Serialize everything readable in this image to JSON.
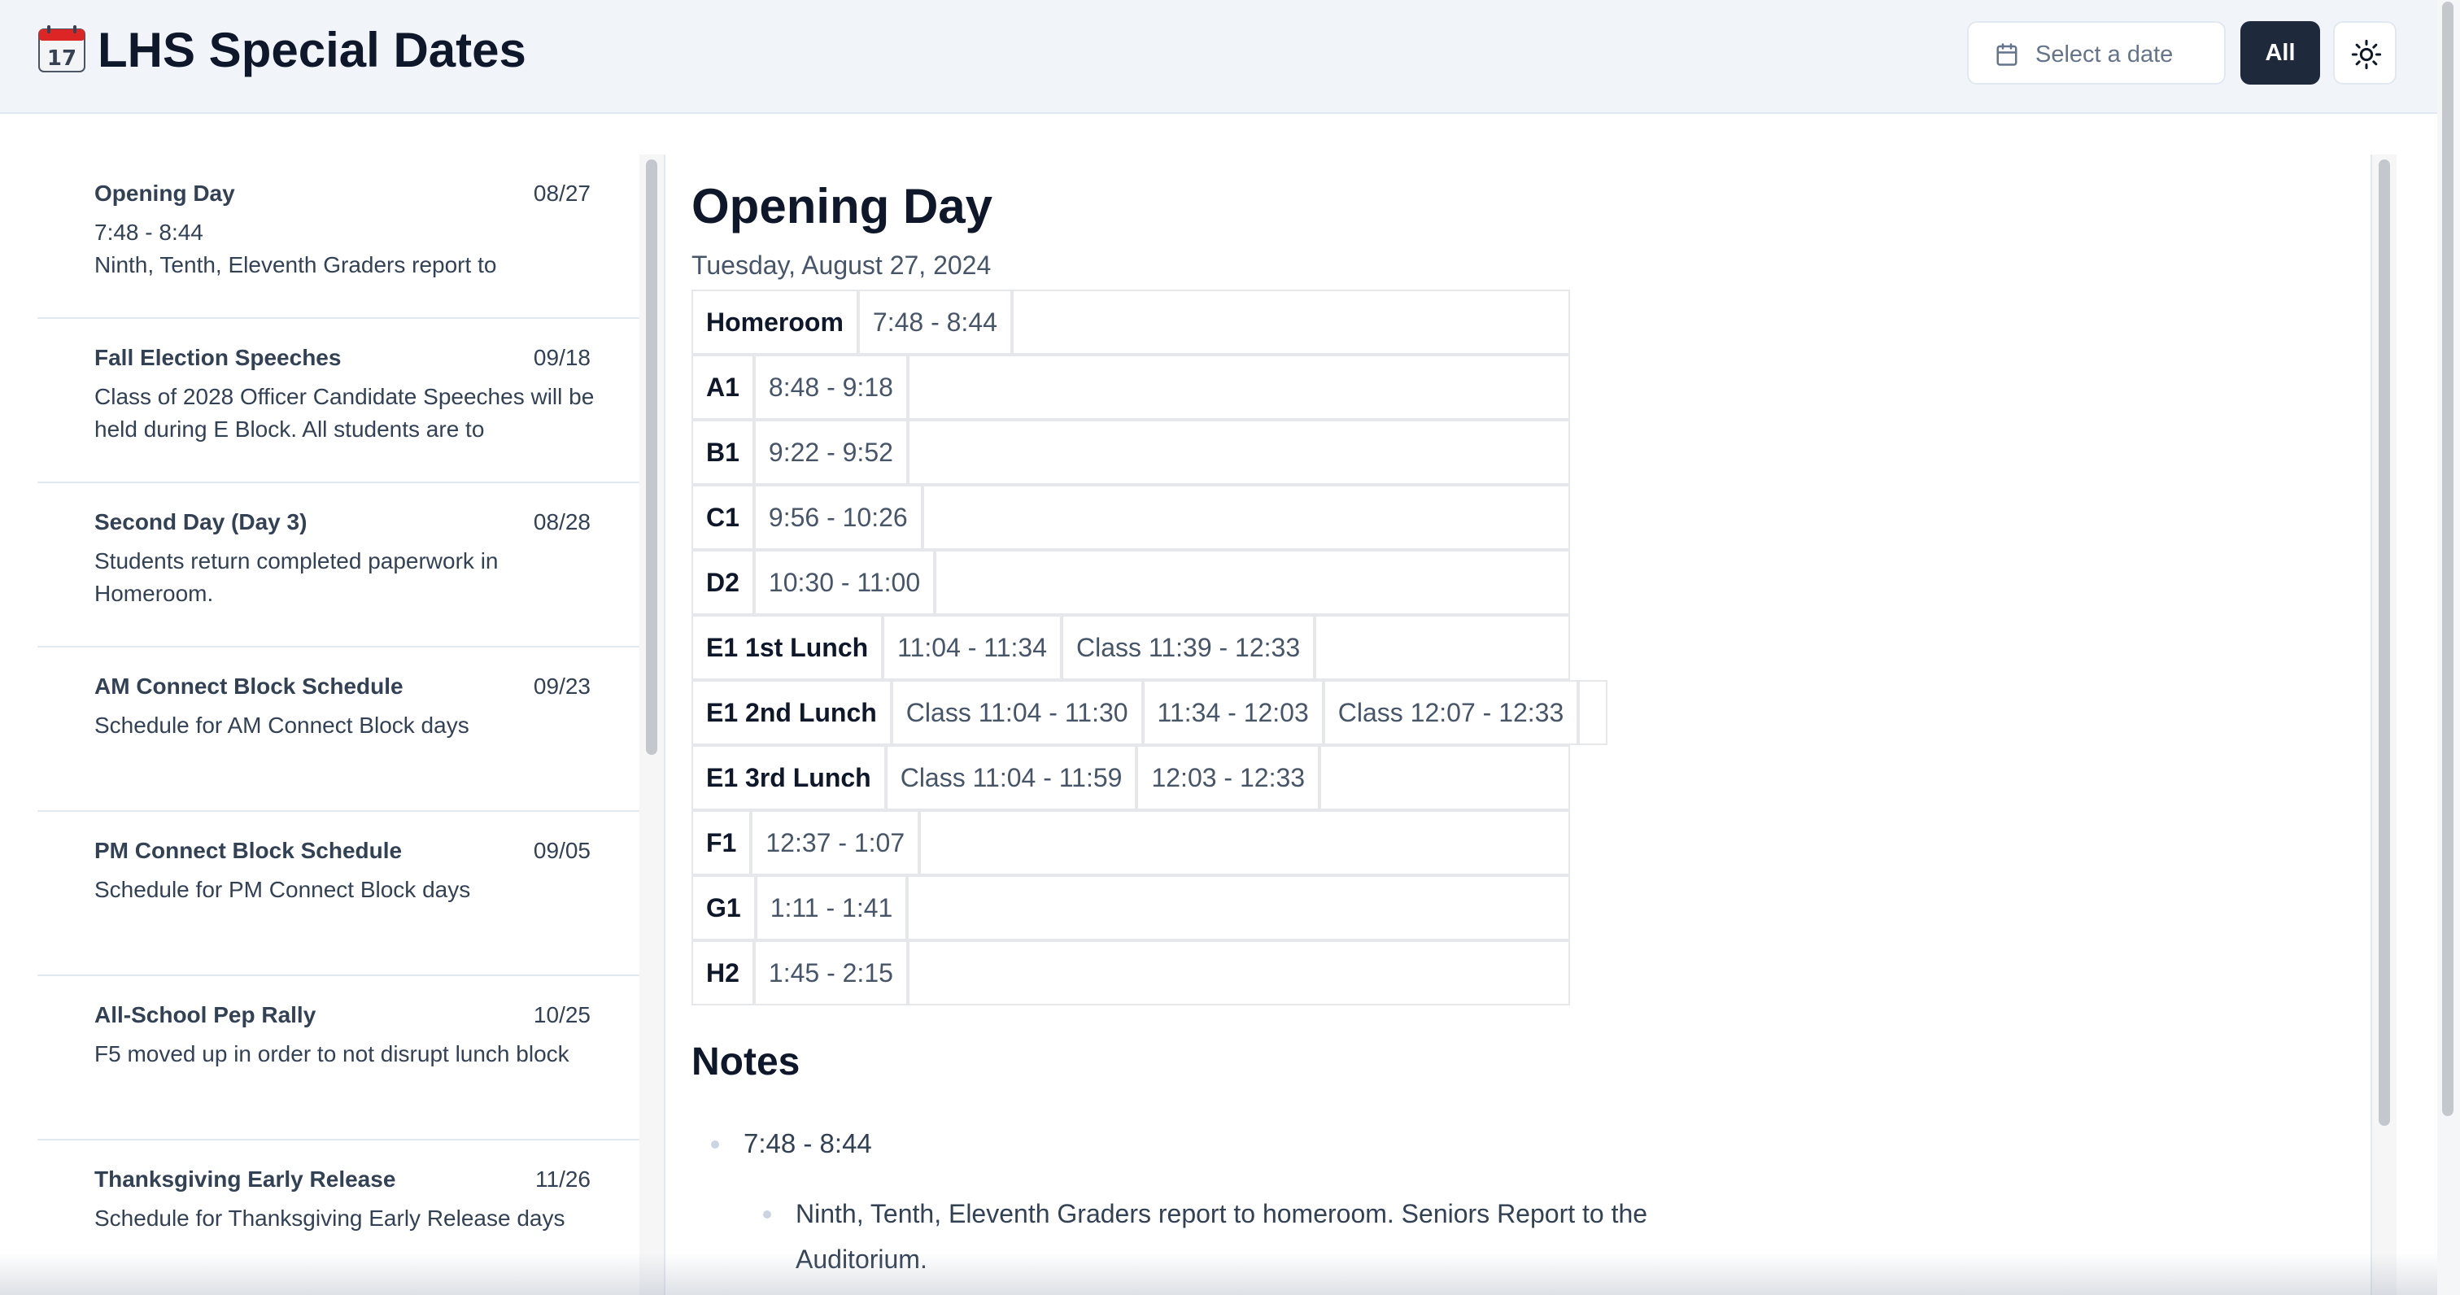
{
  "header": {
    "icon": "calendar-emoji-icon",
    "icon_day": "17",
    "title": "LHS Special Dates",
    "date_picker": {
      "placeholder": "Select a date",
      "icon": "calendar-icon"
    },
    "all_button": "All",
    "theme_toggle_icon": "sun-icon"
  },
  "list": {
    "items": [
      {
        "title": "Opening Day",
        "date": "08/27",
        "text": "7:48 - 8:44\nNinth, Tenth, Eleventh Graders report to"
      },
      {
        "title": "Fall Election Speeches",
        "date": "09/18",
        "text": "Class of 2028 Officer Candidate Speeches will be held during E Block. All students are to"
      },
      {
        "title": "Second Day (Day 3)",
        "date": "08/28",
        "text": "Students return completed paperwork in Homeroom."
      },
      {
        "title": "AM Connect Block Schedule",
        "date": "09/23",
        "text": "Schedule for AM Connect Block days"
      },
      {
        "title": "PM Connect Block Schedule",
        "date": "09/05",
        "text": "Schedule for PM Connect Block days"
      },
      {
        "title": "All-School Pep Rally",
        "date": "10/25",
        "text": "F5 moved up in order to not disrupt lunch block"
      },
      {
        "title": "Thanksgiving Early Release",
        "date": "11/26",
        "text": "Schedule for Thanksgiving Early Release days"
      }
    ]
  },
  "detail": {
    "title": "Opening Day",
    "date": "Tuesday, August 27, 2024",
    "schedule": [
      {
        "block": "Homeroom",
        "cells": [
          "7:48 - 8:44"
        ]
      },
      {
        "block": "A1",
        "cells": [
          "8:48 - 9:18"
        ]
      },
      {
        "block": "B1",
        "cells": [
          "9:22 - 9:52"
        ]
      },
      {
        "block": "C1",
        "cells": [
          "9:56 - 10:26"
        ]
      },
      {
        "block": "D2",
        "cells": [
          "10:30 - 11:00"
        ]
      },
      {
        "block": "E1 1st Lunch",
        "cells": [
          "11:04 - 11:34",
          "Class 11:39 - 12:33"
        ]
      },
      {
        "block": "E1 2nd Lunch",
        "cells": [
          "Class 11:04 - 11:30",
          "11:34 - 12:03",
          "Class 12:07 - 12:33"
        ]
      },
      {
        "block": "E1 3rd Lunch",
        "cells": [
          "Class 11:04 - 11:59",
          "12:03 - 12:33"
        ]
      },
      {
        "block": "F1",
        "cells": [
          "12:37 - 1:07"
        ]
      },
      {
        "block": "G1",
        "cells": [
          "1:11 - 1:41"
        ]
      },
      {
        "block": "H2",
        "cells": [
          "1:45 - 2:15"
        ]
      }
    ],
    "notes_heading": "Notes",
    "notes": [
      {
        "text": "7:48 - 8:44",
        "sub": [
          "Ninth, Tenth, Eleventh Graders report to homeroom. Seniors Report to the Auditorium."
        ]
      }
    ]
  },
  "colors": {
    "header_bg": "#f1f5f9",
    "primary_button": "#1e293b",
    "border": "#e2e8f0",
    "text": "#0f172a",
    "muted_text": "#475569"
  }
}
